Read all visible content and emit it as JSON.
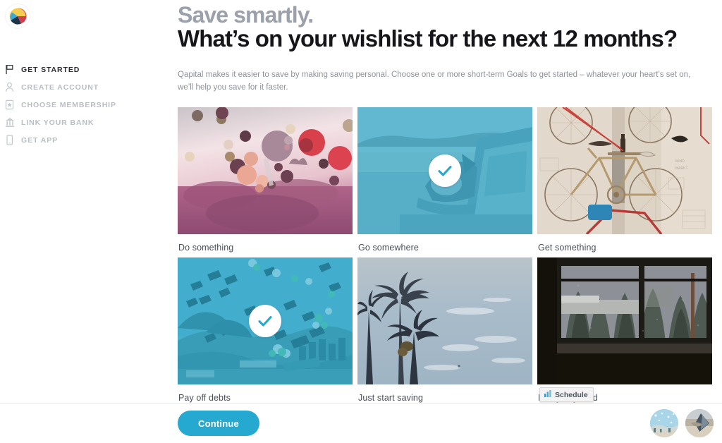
{
  "brand": {
    "logo_name": "qapital-logo",
    "accent_color": "#25a9d0",
    "selected_tint_color": "#28aacd",
    "logo_colors": {
      "yellow": "#f5cd4e",
      "red": "#d23f4a",
      "blue": "#3aa9d6",
      "navy": "#1d3449"
    }
  },
  "sidebar": {
    "items": [
      {
        "label": "GET STARTED",
        "icon": "flag-icon",
        "active": true
      },
      {
        "label": "CREATE ACCOUNT",
        "icon": "person-icon",
        "active": false
      },
      {
        "label": "CHOOSE MEMBERSHIP",
        "icon": "card-star-icon",
        "active": false
      },
      {
        "label": "LINK YOUR BANK",
        "icon": "bank-icon",
        "active": false
      },
      {
        "label": "GET APP",
        "icon": "phone-icon",
        "active": false
      }
    ]
  },
  "main": {
    "eyebrow": "Save smartly.",
    "headline": "What’s on your wishlist for the next 12 months?",
    "subcopy": "Qapital makes it easier to save by making saving personal. Choose one or more short-term Goals to get started – whatever your heart’s set on, we’ll help you save for it faster."
  },
  "goals": {
    "rows": [
      [
        {
          "label": "Do something",
          "selected": false,
          "art": "balloons",
          "art_name": "hot-air-balloons-photo"
        },
        {
          "label": "Go somewhere",
          "selected": true,
          "art": "dog-car",
          "art_name": "dog-in-car-window-photo"
        },
        {
          "label": "Get something",
          "selected": false,
          "art": "bikes",
          "art_name": "bicycles-on-wall-photo"
        }
      ],
      [
        {
          "label": "Pay off debts",
          "selected": true,
          "art": "graduation",
          "art_name": "graduation-caps-photo"
        },
        {
          "label": "Just start saving",
          "selected": false,
          "art": "palms",
          "art_name": "palm-trees-photo"
        },
        {
          "label": "Rainy day fund",
          "selected": false,
          "art": "window",
          "art_name": "rainy-window-photo"
        }
      ]
    ],
    "check_icon": "checkmark-icon"
  },
  "footer": {
    "continue_label": "Continue",
    "avatars": [
      {
        "name": "avatar-goal-1",
        "art": "beach-blue"
      },
      {
        "name": "avatar-goal-2",
        "art": "boat-sand"
      }
    ]
  },
  "overlay": {
    "schedule_label": "Schedule",
    "schedule_icon": "bar-chart-icon"
  }
}
